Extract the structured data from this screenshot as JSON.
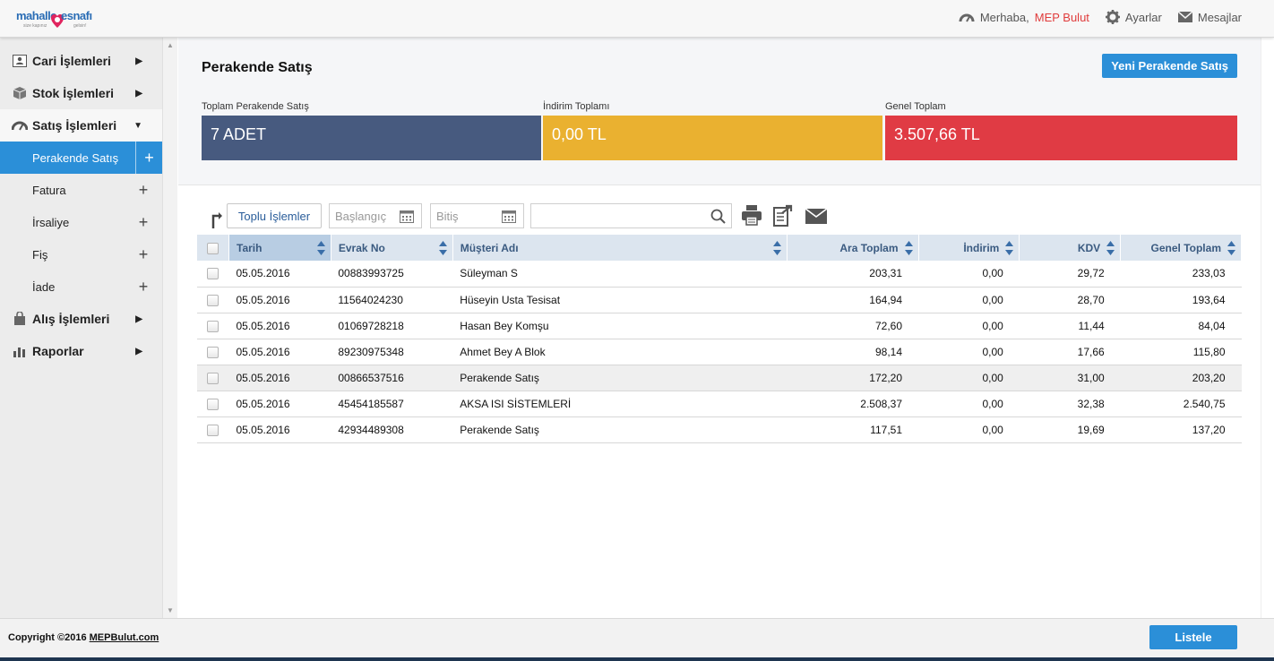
{
  "brand": {
    "word1": "mahalle",
    "word2": "esnafı",
    "tag1": "size kapınız",
    "tag2": "gelsin!"
  },
  "header": {
    "greeting": "Merhaba,",
    "user": "MEP Bulut",
    "settings": "Ayarlar",
    "messages": "Mesajlar"
  },
  "sidebar": {
    "items": [
      {
        "label": "Cari İşlemleri",
        "icon": "contact-card-icon"
      },
      {
        "label": "Stok İşlemleri",
        "icon": "box-icon"
      },
      {
        "label": "Satış İşlemleri",
        "icon": "speedometer-icon"
      },
      {
        "label": "Alış İşlemleri",
        "icon": "shopping-bag-icon"
      },
      {
        "label": "Raporlar",
        "icon": "bar-chart-icon"
      }
    ],
    "sub": [
      "Perakende Satış",
      "Fatura",
      "İrsaliye",
      "Fiş",
      "İade"
    ]
  },
  "page": {
    "title": "Perakende Satış",
    "new_button": "Yeni Perakende Satış"
  },
  "stats": [
    {
      "label": "Toplam Perakende Satış",
      "value": "7 ADET",
      "color": "#475a7f"
    },
    {
      "label": "İndirim Toplamı",
      "value": "0,00 TL",
      "color": "#eab130"
    },
    {
      "label": "Genel Toplam",
      "value": "3.507,66 TL",
      "color": "#e03b44"
    }
  ],
  "toolbar": {
    "bulk": "Toplu İşlemler",
    "start_placeholder": "Başlangıç",
    "end_placeholder": "Bitiş",
    "search_value": ""
  },
  "table": {
    "columns": [
      "Tarih",
      "Evrak No",
      "Müşteri Adı",
      "Ara Toplam",
      "İndirim",
      "KDV",
      "Genel Toplam"
    ],
    "rows": [
      [
        "05.05.2016",
        "00883993725",
        "Süleyman S",
        "203,31",
        "0,00",
        "29,72",
        "233,03"
      ],
      [
        "05.05.2016",
        "11564024230",
        "Hüseyin Usta Tesisat",
        "164,94",
        "0,00",
        "28,70",
        "193,64"
      ],
      [
        "05.05.2016",
        "01069728218",
        "Hasan Bey Komşu",
        "72,60",
        "0,00",
        "11,44",
        "84,04"
      ],
      [
        "05.05.2016",
        "89230975348",
        "Ahmet Bey A Blok",
        "98,14",
        "0,00",
        "17,66",
        "115,80"
      ],
      [
        "05.05.2016",
        "00866537516",
        "Perakende Satış",
        "172,20",
        "0,00",
        "31,00",
        "203,20"
      ],
      [
        "05.05.2016",
        "45454185587",
        "AKSA ISI SİSTEMLERİ",
        "2.508,37",
        "0,00",
        "32,38",
        "2.540,75"
      ],
      [
        "05.05.2016",
        "42934489308",
        "Perakende Satış",
        "117,51",
        "0,00",
        "19,69",
        "137,20"
      ]
    ]
  },
  "footer": {
    "copyright": "Copyright ©2016",
    "link": "MEPBulut.com",
    "list_button": "Listele"
  }
}
